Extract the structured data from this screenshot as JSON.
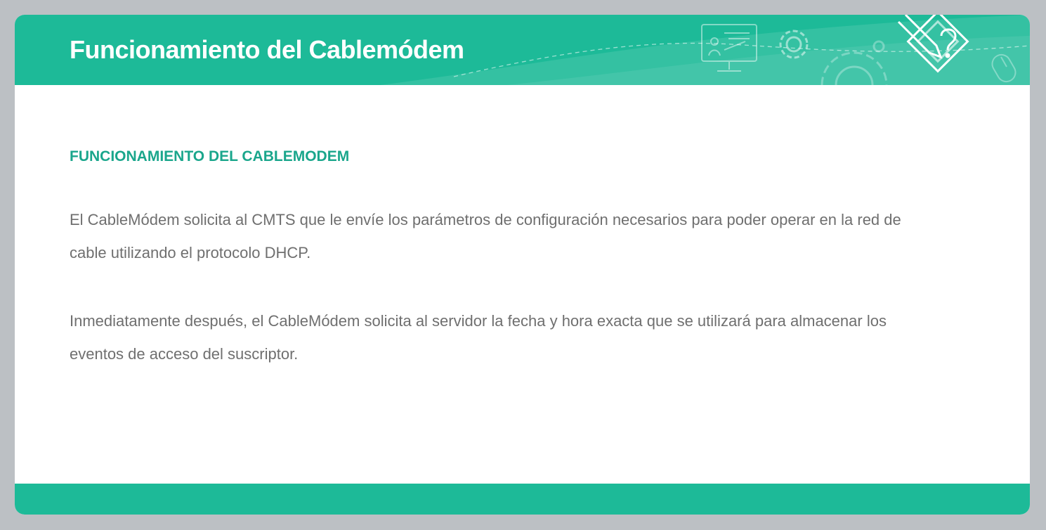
{
  "header": {
    "title": "Funcionamiento del Cablemódem",
    "icons": [
      "monitor-presentation-icon",
      "gear-icon",
      "large-gear-icon",
      "pencil-question-diamond-icon",
      "mouse-icon"
    ]
  },
  "content": {
    "heading": "FUNCIONAMIENTO DEL CABLEMODEM",
    "paragraphs": [
      "El CableMódem solicita al CMTS que le envíe los parámetros de configuración necesarios para poder operar en la red de cable utilizando el protocolo DHCP.",
      "Inmediatamente después, el CableMódem solicita al servidor la fecha y hora exacta que se utilizará para almacenar los eventos de acceso del suscriptor."
    ]
  },
  "colors": {
    "accent": "#1dba98",
    "heading": "#1aa68c",
    "body_text": "#6f6f6f",
    "frame": "#bcc0c4",
    "card": "#ffffff"
  }
}
